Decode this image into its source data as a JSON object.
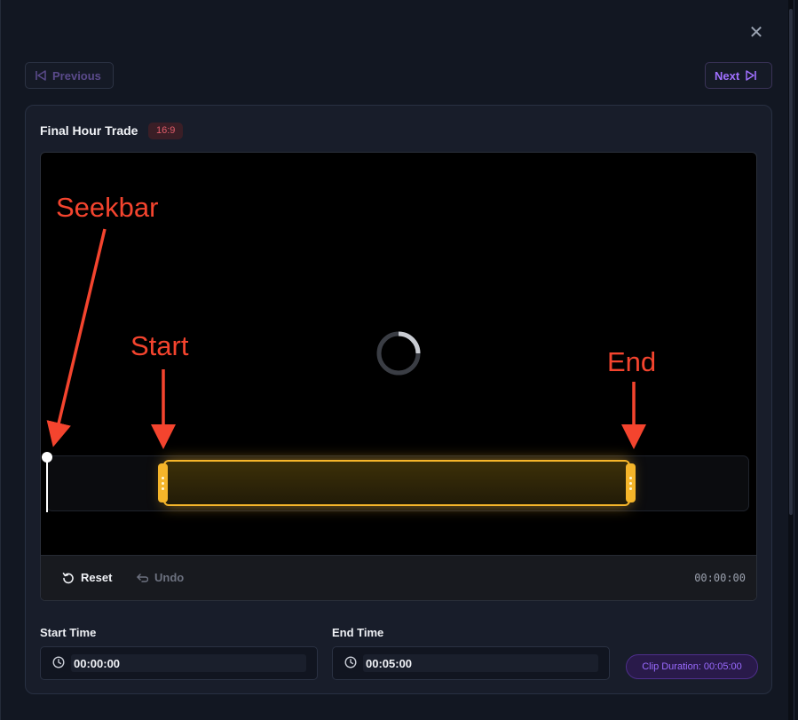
{
  "navigation": {
    "previous_label": "Previous",
    "next_label": "Next"
  },
  "clip": {
    "title": "Final Hour Trade",
    "aspect_ratio": "16:9"
  },
  "annotations": {
    "seekbar": "Seekbar",
    "start": "Start",
    "end": "End"
  },
  "controls": {
    "reset_label": "Reset",
    "undo_label": "Undo",
    "current_time": "00:00:00"
  },
  "start_time": {
    "label": "Start Time",
    "value": "00:00:00"
  },
  "end_time": {
    "label": "End Time",
    "value": "00:05:00"
  },
  "clip_duration": "Clip Duration: 00:05:00",
  "colors": {
    "accent": "#a070ff",
    "clip_highlight": "#f5b52a",
    "annotation": "#f4442e",
    "badge": "#e05c6a"
  }
}
